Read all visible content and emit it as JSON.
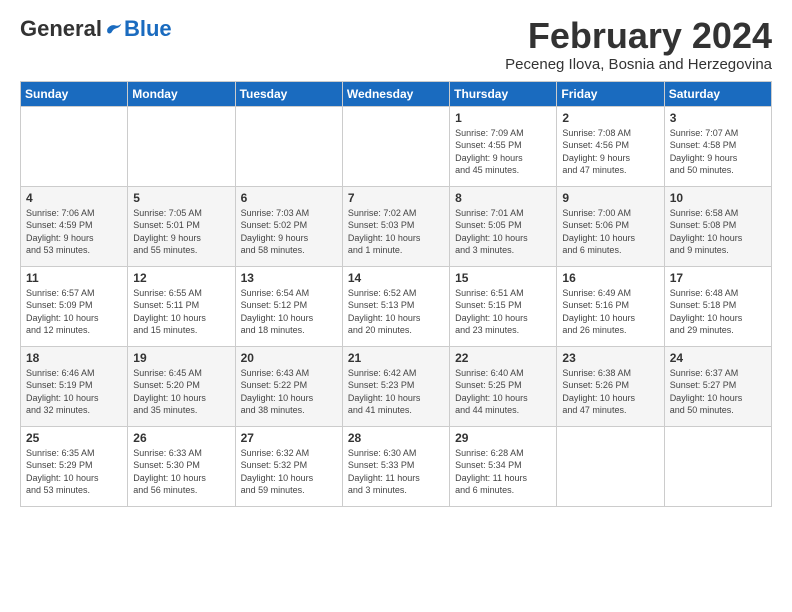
{
  "logo": {
    "general": "General",
    "blue": "Blue"
  },
  "title": {
    "month_year": "February 2024",
    "location": "Peceneg Ilova, Bosnia and Herzegovina"
  },
  "headers": [
    "Sunday",
    "Monday",
    "Tuesday",
    "Wednesday",
    "Thursday",
    "Friday",
    "Saturday"
  ],
  "weeks": [
    [
      {
        "day": "",
        "info": ""
      },
      {
        "day": "",
        "info": ""
      },
      {
        "day": "",
        "info": ""
      },
      {
        "day": "",
        "info": ""
      },
      {
        "day": "1",
        "info": "Sunrise: 7:09 AM\nSunset: 4:55 PM\nDaylight: 9 hours\nand 45 minutes."
      },
      {
        "day": "2",
        "info": "Sunrise: 7:08 AM\nSunset: 4:56 PM\nDaylight: 9 hours\nand 47 minutes."
      },
      {
        "day": "3",
        "info": "Sunrise: 7:07 AM\nSunset: 4:58 PM\nDaylight: 9 hours\nand 50 minutes."
      }
    ],
    [
      {
        "day": "4",
        "info": "Sunrise: 7:06 AM\nSunset: 4:59 PM\nDaylight: 9 hours\nand 53 minutes."
      },
      {
        "day": "5",
        "info": "Sunrise: 7:05 AM\nSunset: 5:01 PM\nDaylight: 9 hours\nand 55 minutes."
      },
      {
        "day": "6",
        "info": "Sunrise: 7:03 AM\nSunset: 5:02 PM\nDaylight: 9 hours\nand 58 minutes."
      },
      {
        "day": "7",
        "info": "Sunrise: 7:02 AM\nSunset: 5:03 PM\nDaylight: 10 hours\nand 1 minute."
      },
      {
        "day": "8",
        "info": "Sunrise: 7:01 AM\nSunset: 5:05 PM\nDaylight: 10 hours\nand 3 minutes."
      },
      {
        "day": "9",
        "info": "Sunrise: 7:00 AM\nSunset: 5:06 PM\nDaylight: 10 hours\nand 6 minutes."
      },
      {
        "day": "10",
        "info": "Sunrise: 6:58 AM\nSunset: 5:08 PM\nDaylight: 10 hours\nand 9 minutes."
      }
    ],
    [
      {
        "day": "11",
        "info": "Sunrise: 6:57 AM\nSunset: 5:09 PM\nDaylight: 10 hours\nand 12 minutes."
      },
      {
        "day": "12",
        "info": "Sunrise: 6:55 AM\nSunset: 5:11 PM\nDaylight: 10 hours\nand 15 minutes."
      },
      {
        "day": "13",
        "info": "Sunrise: 6:54 AM\nSunset: 5:12 PM\nDaylight: 10 hours\nand 18 minutes."
      },
      {
        "day": "14",
        "info": "Sunrise: 6:52 AM\nSunset: 5:13 PM\nDaylight: 10 hours\nand 20 minutes."
      },
      {
        "day": "15",
        "info": "Sunrise: 6:51 AM\nSunset: 5:15 PM\nDaylight: 10 hours\nand 23 minutes."
      },
      {
        "day": "16",
        "info": "Sunrise: 6:49 AM\nSunset: 5:16 PM\nDaylight: 10 hours\nand 26 minutes."
      },
      {
        "day": "17",
        "info": "Sunrise: 6:48 AM\nSunset: 5:18 PM\nDaylight: 10 hours\nand 29 minutes."
      }
    ],
    [
      {
        "day": "18",
        "info": "Sunrise: 6:46 AM\nSunset: 5:19 PM\nDaylight: 10 hours\nand 32 minutes."
      },
      {
        "day": "19",
        "info": "Sunrise: 6:45 AM\nSunset: 5:20 PM\nDaylight: 10 hours\nand 35 minutes."
      },
      {
        "day": "20",
        "info": "Sunrise: 6:43 AM\nSunset: 5:22 PM\nDaylight: 10 hours\nand 38 minutes."
      },
      {
        "day": "21",
        "info": "Sunrise: 6:42 AM\nSunset: 5:23 PM\nDaylight: 10 hours\nand 41 minutes."
      },
      {
        "day": "22",
        "info": "Sunrise: 6:40 AM\nSunset: 5:25 PM\nDaylight: 10 hours\nand 44 minutes."
      },
      {
        "day": "23",
        "info": "Sunrise: 6:38 AM\nSunset: 5:26 PM\nDaylight: 10 hours\nand 47 minutes."
      },
      {
        "day": "24",
        "info": "Sunrise: 6:37 AM\nSunset: 5:27 PM\nDaylight: 10 hours\nand 50 minutes."
      }
    ],
    [
      {
        "day": "25",
        "info": "Sunrise: 6:35 AM\nSunset: 5:29 PM\nDaylight: 10 hours\nand 53 minutes."
      },
      {
        "day": "26",
        "info": "Sunrise: 6:33 AM\nSunset: 5:30 PM\nDaylight: 10 hours\nand 56 minutes."
      },
      {
        "day": "27",
        "info": "Sunrise: 6:32 AM\nSunset: 5:32 PM\nDaylight: 10 hours\nand 59 minutes."
      },
      {
        "day": "28",
        "info": "Sunrise: 6:30 AM\nSunset: 5:33 PM\nDaylight: 11 hours\nand 3 minutes."
      },
      {
        "day": "29",
        "info": "Sunrise: 6:28 AM\nSunset: 5:34 PM\nDaylight: 11 hours\nand 6 minutes."
      },
      {
        "day": "",
        "info": ""
      },
      {
        "day": "",
        "info": ""
      }
    ]
  ]
}
